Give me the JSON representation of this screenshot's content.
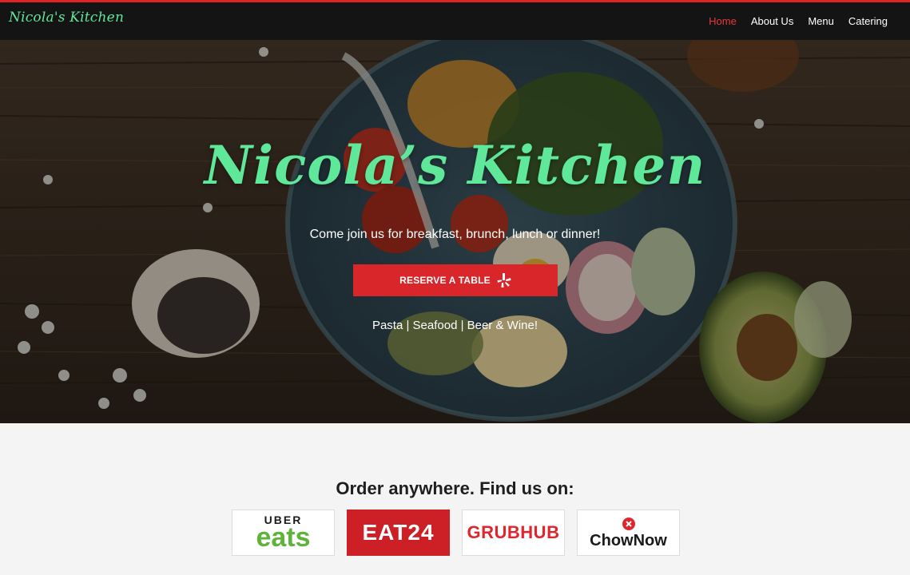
{
  "header": {
    "brand": "Nicola's Kitchen",
    "nav": [
      {
        "label": "Home",
        "active": true
      },
      {
        "label": "About Us",
        "active": false
      },
      {
        "label": "Menu",
        "active": false
      },
      {
        "label": "Catering",
        "active": false
      }
    ]
  },
  "hero": {
    "title": "Nicola’s Kitchen",
    "subtitle": "Come join us for breakfast, brunch, lunch or dinner!",
    "cta_label": "RESERVE A TABLE",
    "cta_icon": "yelp-icon",
    "tags": "Pasta | Seafood | Beer & Wine!"
  },
  "order": {
    "title": "Order anywhere. Find us on:",
    "partners": [
      {
        "name": "ubereats",
        "line1": "UBER",
        "line2": "eats"
      },
      {
        "name": "eat24",
        "text": "EAT24"
      },
      {
        "name": "grubhub",
        "text": "GRUBHUB"
      },
      {
        "name": "chownow",
        "text": "ChowNow"
      }
    ]
  },
  "colors": {
    "accent_red": "#d8262b",
    "brand_green": "#5fe89a",
    "nav_bg": "#141414"
  }
}
